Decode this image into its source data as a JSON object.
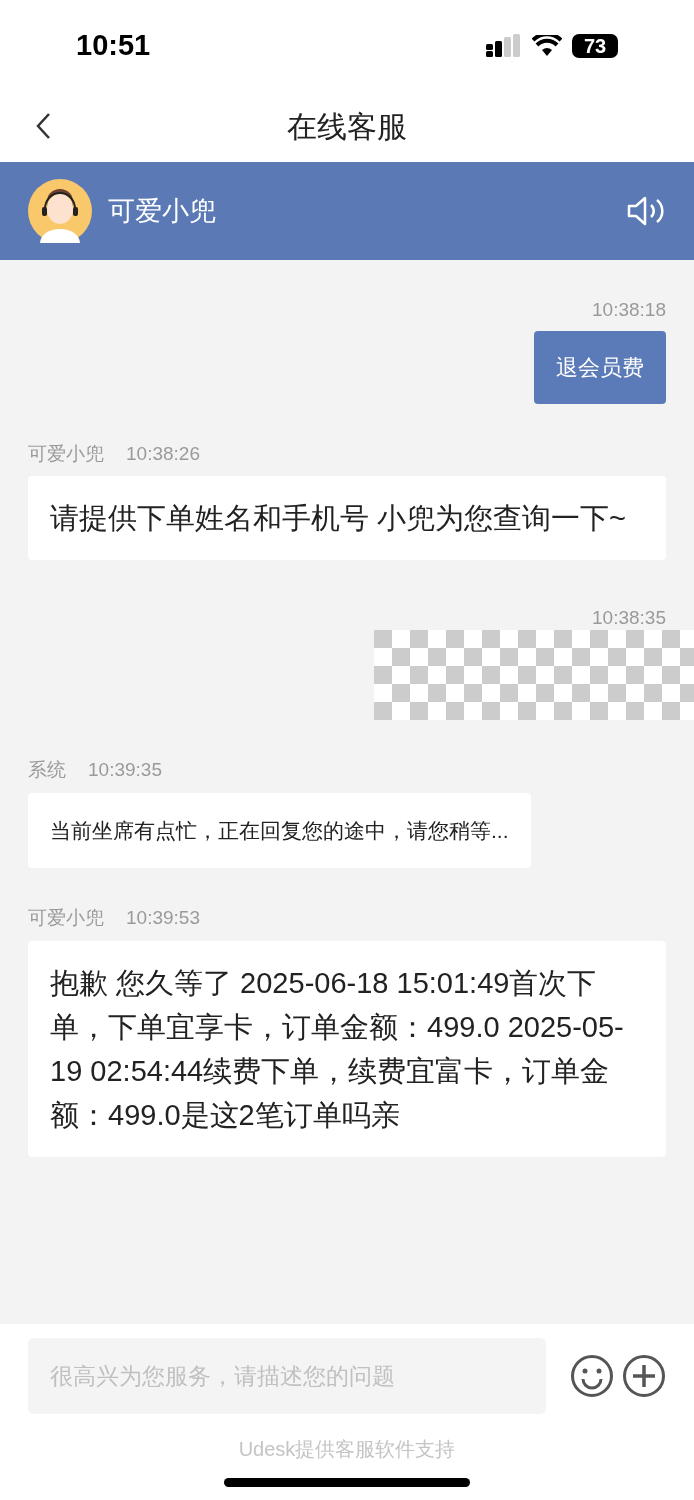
{
  "status_bar": {
    "time": "10:51",
    "battery": "73"
  },
  "nav": {
    "title": "在线客服"
  },
  "agent": {
    "name": "可爱小兜"
  },
  "messages": [
    {
      "kind": "outgoing",
      "time": "10:38:18",
      "text": "退会员费"
    },
    {
      "kind": "incoming",
      "sender": "可爱小兜",
      "time": "10:38:26",
      "text": "请提供下单姓名和手机号 小兜为您查询一下~"
    },
    {
      "kind": "redacted",
      "time": "10:38:35"
    },
    {
      "kind": "system",
      "sender": "系统",
      "time": "10:39:35",
      "text": "当前坐席有点忙，正在回复您的途中，请您稍等..."
    },
    {
      "kind": "incoming",
      "sender": "可爱小兜",
      "time": "10:39:53",
      "text": "抱歉 您久等了 2025-06-18 15:01:49首次下单，下单宜享卡，订单金额：499.0 2025-05-19 02:54:44续费下单，续费宜富卡，订单金额：499.0是这2笔订单吗亲"
    }
  ],
  "input": {
    "placeholder": "很高兴为您服务，请描述您的问题"
  },
  "footer": "Udesk提供客服软件支持"
}
